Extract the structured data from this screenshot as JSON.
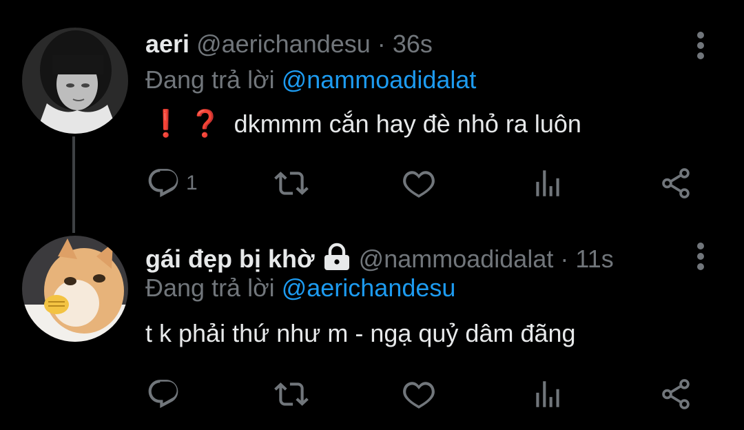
{
  "tweets": [
    {
      "name": "aeri",
      "handle": "@aerichandesu",
      "separator": "·",
      "time": "36s",
      "replying_prefix": "Đang trả lời",
      "replying_to": "@nammoadidalat",
      "emoji_1": "❗",
      "emoji_2": "❓",
      "text": "dkmmm cắn hay đè nhỏ ra luôn",
      "reply_count": "1",
      "locked": false
    },
    {
      "name": "gái đẹp bị khờ",
      "handle": "@nammoadidalat",
      "separator": "·",
      "time": "11s",
      "replying_prefix": "Đang trả lời",
      "replying_to": "@aerichandesu",
      "text": "t k phải thứ như m - ngạ quỷ dâm đãng",
      "reply_count": "",
      "locked": true
    }
  ],
  "icons": {
    "reply": "reply-icon",
    "retweet": "retweet-icon",
    "like": "heart-icon",
    "views": "analytics-icon",
    "share": "share-icon",
    "more": "more-vertical-icon",
    "lock": "lock-icon"
  },
  "colors": {
    "background": "#000000",
    "text": "#e7e9ea",
    "muted": "#71767b",
    "mention": "#1d9bf0",
    "thread_line": "#3e4144"
  }
}
